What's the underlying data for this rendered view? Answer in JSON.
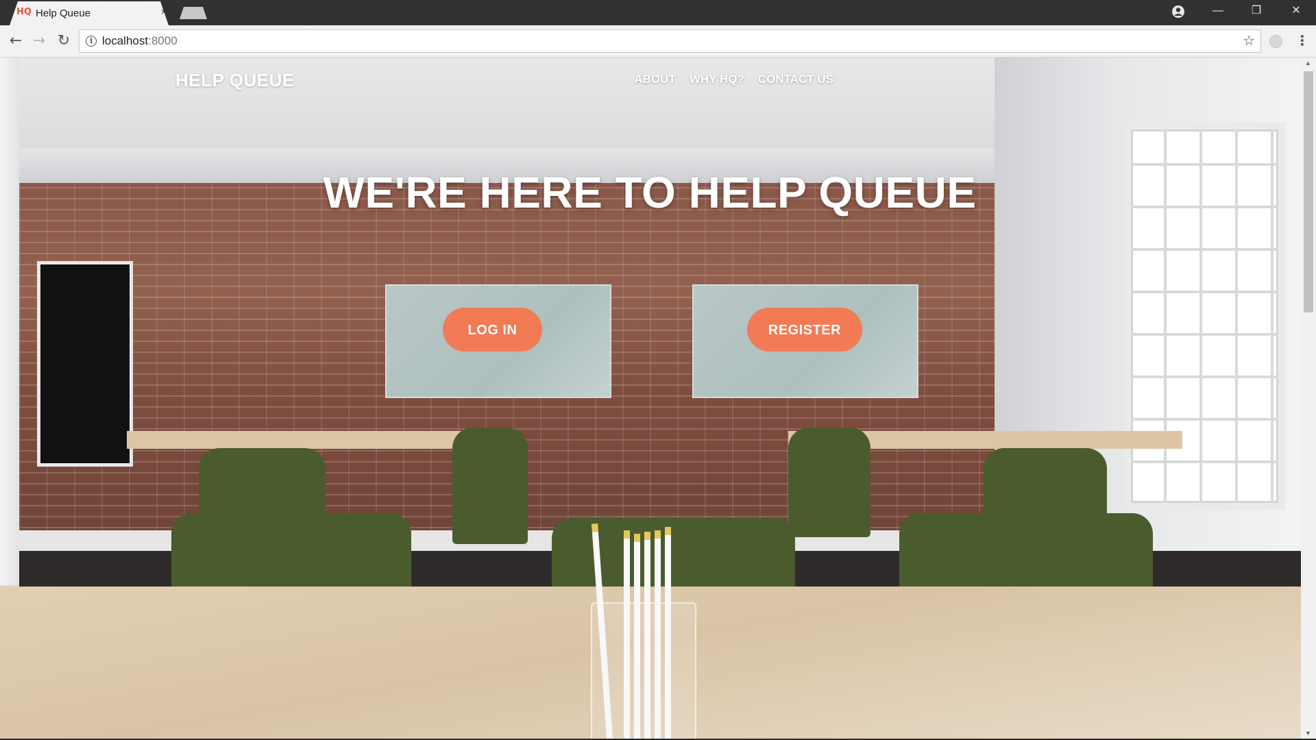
{
  "browser": {
    "tab_title": "Help Queue",
    "favicon_text": "HQ",
    "tab_close": "×",
    "url_host": "localhost",
    "url_port": ":8000",
    "window_controls": {
      "minimize": "—",
      "restore": "❐",
      "close": "✕"
    },
    "nav": {
      "back": "←",
      "forward": "→",
      "reload": "↻"
    },
    "star": "☆",
    "menu": "⋮",
    "info": "i"
  },
  "page": {
    "brand": "HELP QUEUE",
    "nav_links": [
      "ABOUT",
      "WHY HQ?",
      "CONTACT US"
    ],
    "hero_title": "WE'RE HERE TO HELP QUEUE",
    "login_label": "LOG IN",
    "register_label": "REGISTER"
  },
  "colors": {
    "accent": "#f27a55",
    "text_on_image": "#ffffff"
  }
}
